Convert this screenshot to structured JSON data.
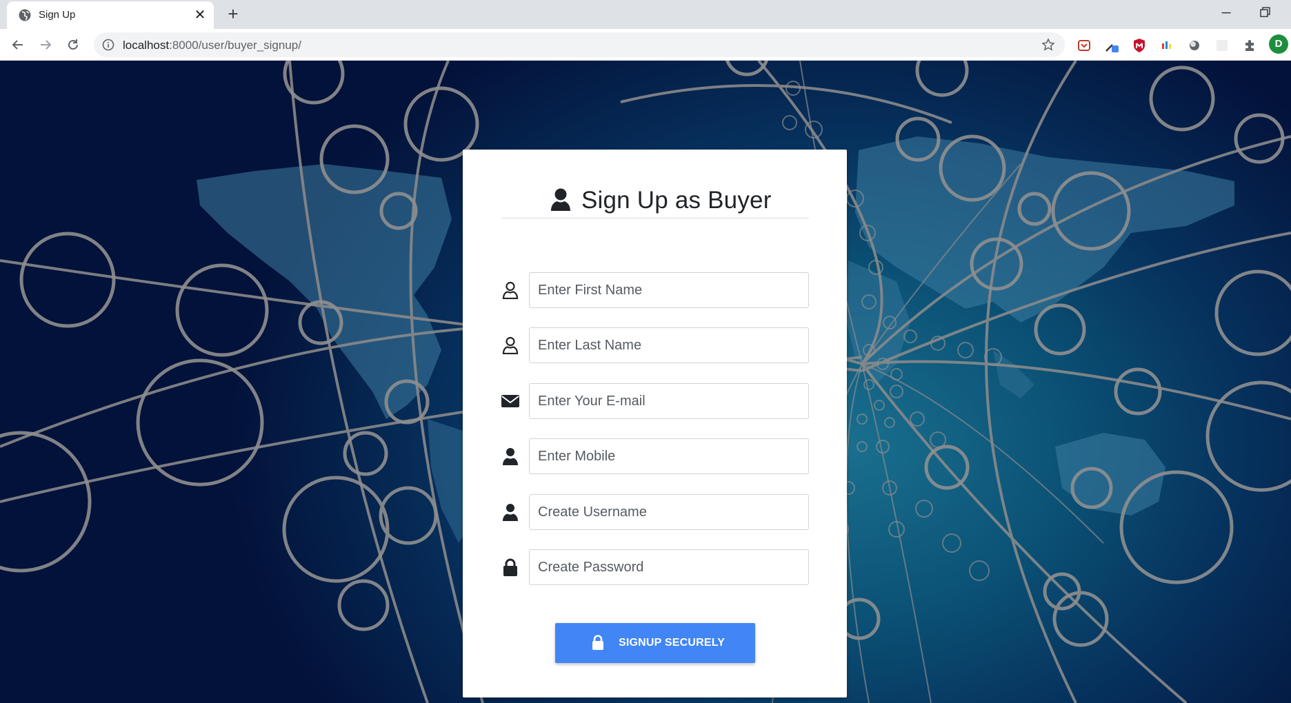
{
  "browser": {
    "tab": {
      "title": "Sign Up",
      "icon": "globe-icon",
      "close": "✕"
    },
    "new_tab": "+",
    "address": {
      "host": "localhost",
      "path": ":8000/user/buyer_signup/"
    },
    "profile_initial": "D",
    "window_min": "─"
  },
  "form": {
    "title": "Sign Up as Buyer",
    "fields": [
      {
        "icon": "user-outline-icon",
        "placeholder": "Enter First Name"
      },
      {
        "icon": "user-outline-icon",
        "placeholder": "Enter Last Name"
      },
      {
        "icon": "envelope-icon",
        "placeholder": "Enter Your E-mail"
      },
      {
        "icon": "user-icon",
        "placeholder": "Enter Mobile"
      },
      {
        "icon": "user-icon",
        "placeholder": "Create Username"
      },
      {
        "icon": "lock-icon",
        "placeholder": "Create Password"
      }
    ],
    "submit_label": "SIGNUP SECURELY",
    "submit_icon": "lock-icon"
  },
  "colors": {
    "button": "#4285f4",
    "profile": "#1e8e3e",
    "card": "#ffffff"
  }
}
